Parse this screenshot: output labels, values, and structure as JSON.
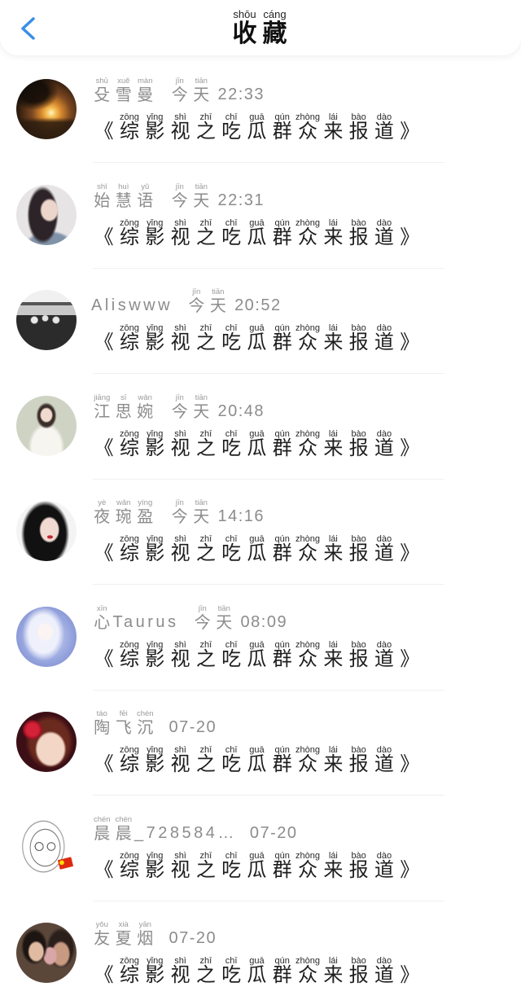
{
  "header": {
    "back_icon": "chevron-left-icon",
    "title": [
      {
        "c": "收",
        "py": "shōu"
      },
      {
        "c": "藏",
        "py": "cáng"
      }
    ]
  },
  "colors": {
    "accent": "#3a8ee6",
    "meta_text": "#8c8c8c",
    "title_text": "#1e1e1e"
  },
  "items": [
    {
      "name": [
        {
          "c": "殳",
          "py": "shū"
        },
        {
          "c": "雪",
          "py": "xuě"
        },
        {
          "c": "曼",
          "py": "màn"
        }
      ],
      "time": [
        {
          "c": "今",
          "py": "jīn"
        },
        {
          "c": "天",
          "py": "tiān"
        },
        {
          "c": "22:33"
        }
      ],
      "title": [
        {
          "c": "《"
        },
        {
          "c": "综",
          "py": "zōng"
        },
        {
          "c": "影",
          "py": "yǐng"
        },
        {
          "c": "视",
          "py": "shì"
        },
        {
          "c": "之",
          "py": "zhī"
        },
        {
          "c": "吃",
          "py": "chī"
        },
        {
          "c": "瓜",
          "py": "guā"
        },
        {
          "c": "群",
          "py": "qún"
        },
        {
          "c": "众",
          "py": "zhòng"
        },
        {
          "c": "来",
          "py": "lái"
        },
        {
          "c": "报",
          "py": "bào"
        },
        {
          "c": "道",
          "py": "dào"
        },
        {
          "c": "》"
        }
      ]
    },
    {
      "name": [
        {
          "c": "始",
          "py": "shǐ"
        },
        {
          "c": "慧",
          "py": "huì"
        },
        {
          "c": "语",
          "py": "yǔ"
        }
      ],
      "time": [
        {
          "c": "今",
          "py": "jīn"
        },
        {
          "c": "天",
          "py": "tiān"
        },
        {
          "c": "22:31"
        }
      ],
      "title": [
        {
          "c": "《"
        },
        {
          "c": "综",
          "py": "zōng"
        },
        {
          "c": "影",
          "py": "yǐng"
        },
        {
          "c": "视",
          "py": "shì"
        },
        {
          "c": "之",
          "py": "zhī"
        },
        {
          "c": "吃",
          "py": "chī"
        },
        {
          "c": "瓜",
          "py": "guā"
        },
        {
          "c": "群",
          "py": "qún"
        },
        {
          "c": "众",
          "py": "zhòng"
        },
        {
          "c": "来",
          "py": "lái"
        },
        {
          "c": "报",
          "py": "bào"
        },
        {
          "c": "道",
          "py": "dào"
        },
        {
          "c": "》"
        }
      ]
    },
    {
      "name": [
        {
          "c": "Aliswww"
        }
      ],
      "time": [
        {
          "c": "今",
          "py": "jīn"
        },
        {
          "c": "天",
          "py": "tiān"
        },
        {
          "c": "20:52"
        }
      ],
      "title": [
        {
          "c": "《"
        },
        {
          "c": "综",
          "py": "zōng"
        },
        {
          "c": "影",
          "py": "yǐng"
        },
        {
          "c": "视",
          "py": "shì"
        },
        {
          "c": "之",
          "py": "zhī"
        },
        {
          "c": "吃",
          "py": "chī"
        },
        {
          "c": "瓜",
          "py": "guā"
        },
        {
          "c": "群",
          "py": "qún"
        },
        {
          "c": "众",
          "py": "zhòng"
        },
        {
          "c": "来",
          "py": "lái"
        },
        {
          "c": "报",
          "py": "bào"
        },
        {
          "c": "道",
          "py": "dào"
        },
        {
          "c": "》"
        }
      ]
    },
    {
      "name": [
        {
          "c": "江",
          "py": "jiāng"
        },
        {
          "c": "思",
          "py": "sī"
        },
        {
          "c": "婉",
          "py": "wǎn"
        }
      ],
      "time": [
        {
          "c": "今",
          "py": "jīn"
        },
        {
          "c": "天",
          "py": "tiān"
        },
        {
          "c": "20:48"
        }
      ],
      "title": [
        {
          "c": "《"
        },
        {
          "c": "综",
          "py": "zōng"
        },
        {
          "c": "影",
          "py": "yǐng"
        },
        {
          "c": "视",
          "py": "shì"
        },
        {
          "c": "之",
          "py": "zhī"
        },
        {
          "c": "吃",
          "py": "chī"
        },
        {
          "c": "瓜",
          "py": "guā"
        },
        {
          "c": "群",
          "py": "qún"
        },
        {
          "c": "众",
          "py": "zhòng"
        },
        {
          "c": "来",
          "py": "lái"
        },
        {
          "c": "报",
          "py": "bào"
        },
        {
          "c": "道",
          "py": "dào"
        },
        {
          "c": "》"
        }
      ]
    },
    {
      "name": [
        {
          "c": "夜",
          "py": "yè"
        },
        {
          "c": "琬",
          "py": "wǎn"
        },
        {
          "c": "盈",
          "py": "yíng"
        }
      ],
      "time": [
        {
          "c": "今",
          "py": "jīn"
        },
        {
          "c": "天",
          "py": "tiān"
        },
        {
          "c": "14:16"
        }
      ],
      "title": [
        {
          "c": "《"
        },
        {
          "c": "综",
          "py": "zōng"
        },
        {
          "c": "影",
          "py": "yǐng"
        },
        {
          "c": "视",
          "py": "shì"
        },
        {
          "c": "之",
          "py": "zhī"
        },
        {
          "c": "吃",
          "py": "chī"
        },
        {
          "c": "瓜",
          "py": "guā"
        },
        {
          "c": "群",
          "py": "qún"
        },
        {
          "c": "众",
          "py": "zhòng"
        },
        {
          "c": "来",
          "py": "lái"
        },
        {
          "c": "报",
          "py": "bào"
        },
        {
          "c": "道",
          "py": "dào"
        },
        {
          "c": "》"
        }
      ]
    },
    {
      "name": [
        {
          "c": "心",
          "py": "xīn"
        },
        {
          "c": "Taurus"
        }
      ],
      "time": [
        {
          "c": "今",
          "py": "jīn"
        },
        {
          "c": "天",
          "py": "tiān"
        },
        {
          "c": "08:09"
        }
      ],
      "title": [
        {
          "c": "《"
        },
        {
          "c": "综",
          "py": "zōng"
        },
        {
          "c": "影",
          "py": "yǐng"
        },
        {
          "c": "视",
          "py": "shì"
        },
        {
          "c": "之",
          "py": "zhī"
        },
        {
          "c": "吃",
          "py": "chī"
        },
        {
          "c": "瓜",
          "py": "guā"
        },
        {
          "c": "群",
          "py": "qún"
        },
        {
          "c": "众",
          "py": "zhòng"
        },
        {
          "c": "来",
          "py": "lái"
        },
        {
          "c": "报",
          "py": "bào"
        },
        {
          "c": "道",
          "py": "dào"
        },
        {
          "c": "》"
        }
      ]
    },
    {
      "name": [
        {
          "c": "陶",
          "py": "táo"
        },
        {
          "c": "飞",
          "py": "fēi"
        },
        {
          "c": "沉",
          "py": "chén"
        }
      ],
      "time": [
        {
          "c": "07-20"
        }
      ],
      "title": [
        {
          "c": "《"
        },
        {
          "c": "综",
          "py": "zōng"
        },
        {
          "c": "影",
          "py": "yǐng"
        },
        {
          "c": "视",
          "py": "shì"
        },
        {
          "c": "之",
          "py": "zhī"
        },
        {
          "c": "吃",
          "py": "chī"
        },
        {
          "c": "瓜",
          "py": "guā"
        },
        {
          "c": "群",
          "py": "qún"
        },
        {
          "c": "众",
          "py": "zhòng"
        },
        {
          "c": "来",
          "py": "lái"
        },
        {
          "c": "报",
          "py": "bào"
        },
        {
          "c": "道",
          "py": "dào"
        },
        {
          "c": "》"
        }
      ]
    },
    {
      "name": [
        {
          "c": "晨",
          "py": "chén"
        },
        {
          "c": "晨",
          "py": "chén"
        },
        {
          "c": "_728584…"
        }
      ],
      "time": [
        {
          "c": "07-20"
        }
      ],
      "title": [
        {
          "c": "《"
        },
        {
          "c": "综",
          "py": "zōng"
        },
        {
          "c": "影",
          "py": "yǐng"
        },
        {
          "c": "视",
          "py": "shì"
        },
        {
          "c": "之",
          "py": "zhī"
        },
        {
          "c": "吃",
          "py": "chī"
        },
        {
          "c": "瓜",
          "py": "guā"
        },
        {
          "c": "群",
          "py": "qún"
        },
        {
          "c": "众",
          "py": "zhòng"
        },
        {
          "c": "来",
          "py": "lái"
        },
        {
          "c": "报",
          "py": "bào"
        },
        {
          "c": "道",
          "py": "dào"
        },
        {
          "c": "》"
        }
      ]
    },
    {
      "name": [
        {
          "c": "友",
          "py": "yǒu"
        },
        {
          "c": "夏",
          "py": "xià"
        },
        {
          "c": "烟",
          "py": "yān"
        }
      ],
      "time": [
        {
          "c": "07-20"
        }
      ],
      "title": [
        {
          "c": "《"
        },
        {
          "c": "综",
          "py": "zōng"
        },
        {
          "c": "影",
          "py": "yǐng"
        },
        {
          "c": "视",
          "py": "shì"
        },
        {
          "c": "之",
          "py": "zhī"
        },
        {
          "c": "吃",
          "py": "chī"
        },
        {
          "c": "瓜",
          "py": "guā"
        },
        {
          "c": "群",
          "py": "qún"
        },
        {
          "c": "众",
          "py": "zhòng"
        },
        {
          "c": "来",
          "py": "lái"
        },
        {
          "c": "报",
          "py": "bào"
        },
        {
          "c": "道",
          "py": "dào"
        },
        {
          "c": "》"
        }
      ]
    }
  ]
}
